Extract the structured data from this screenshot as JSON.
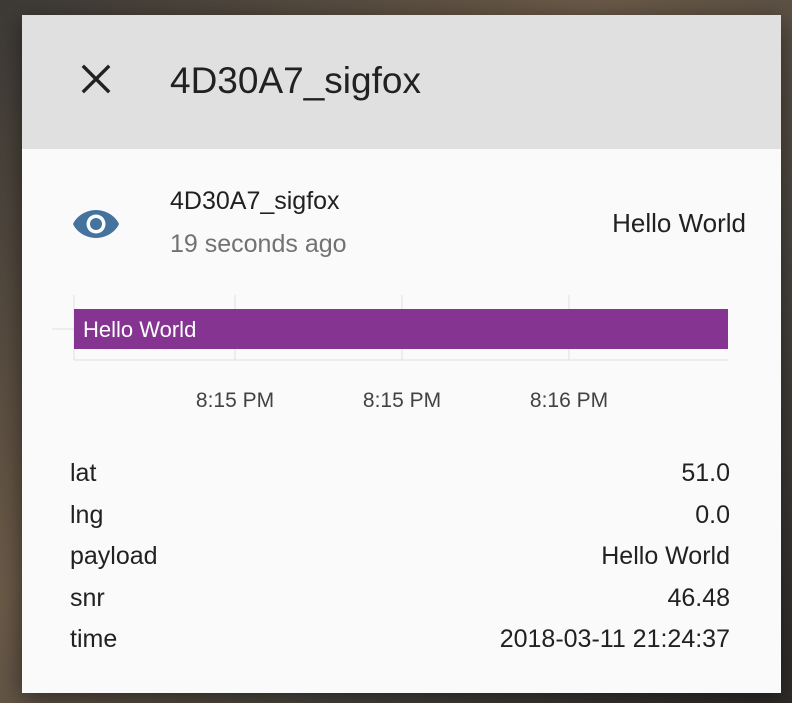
{
  "dialog": {
    "title": "4D30A7_sigfox",
    "close_icon": "close-icon"
  },
  "entity": {
    "name": "4D30A7_sigfox",
    "last_changed": "19 seconds ago",
    "state": "Hello World",
    "icon": "eye-icon",
    "icon_color": "#44739e"
  },
  "chart_data": {
    "type": "bar",
    "title": "",
    "categories": [
      "Hello World"
    ],
    "bar_label": "Hello World",
    "bar_color": "#853591",
    "tick_labels": [
      "8:15 PM",
      "8:15 PM",
      "8:16 PM"
    ],
    "xlabel": "",
    "ylabel": ""
  },
  "attributes": [
    {
      "key": "lat",
      "value": "51.0"
    },
    {
      "key": "lng",
      "value": "0.0"
    },
    {
      "key": "payload",
      "value": "Hello World"
    },
    {
      "key": "snr",
      "value": "46.48"
    },
    {
      "key": "time",
      "value": "2018-03-11 21:24:37"
    }
  ]
}
